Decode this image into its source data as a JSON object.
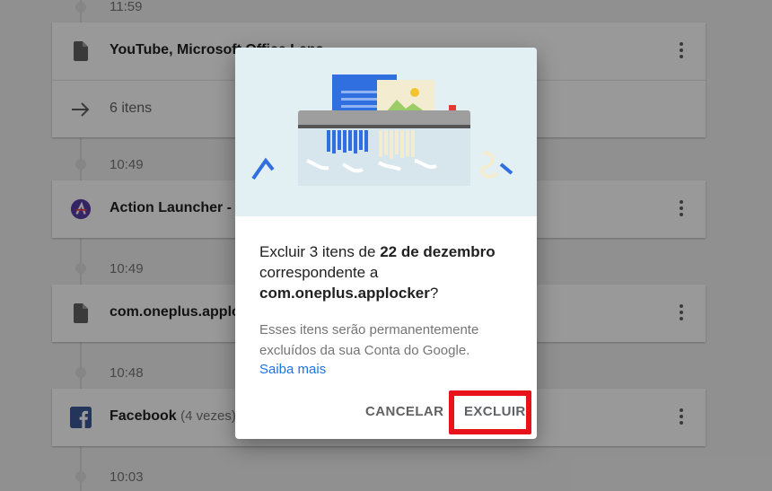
{
  "activity": {
    "entries": [
      {
        "time": "11:59"
      },
      {
        "title": "YouTube, Microsoft Office Lens, ...",
        "icon": "document-icon"
      },
      {
        "sub": "6 itens",
        "icon": "arrow-right-icon"
      },
      {
        "time": "10:49"
      },
      {
        "title": "Action Launcher - O",
        "icon": "action-launcher-icon"
      },
      {
        "time": "10:49"
      },
      {
        "title": "com.oneplus.apploc",
        "icon": "document-icon"
      },
      {
        "time": "10:48"
      },
      {
        "title": "Facebook",
        "count": "(4 vezes)",
        "icon": "facebook-icon"
      },
      {
        "time": "10:03"
      }
    ]
  },
  "dialog": {
    "q_pre": "Excluir 3 itens de ",
    "q_date": "22 de dezembro",
    "q_mid": " correspondente a ",
    "q_app": "com.oneplus.applocker",
    "q_end": "?",
    "note": "Esses itens serão permanentemente excluídos da sua Conta do Google.",
    "learn_more": "Saiba mais",
    "cancel": "CANCELAR",
    "delete": "EXCLUIR"
  },
  "colors": {
    "accent": "#1a73e8",
    "highlight": "#e8121b",
    "scrim": "rgba(0,0,0,0.40)"
  }
}
